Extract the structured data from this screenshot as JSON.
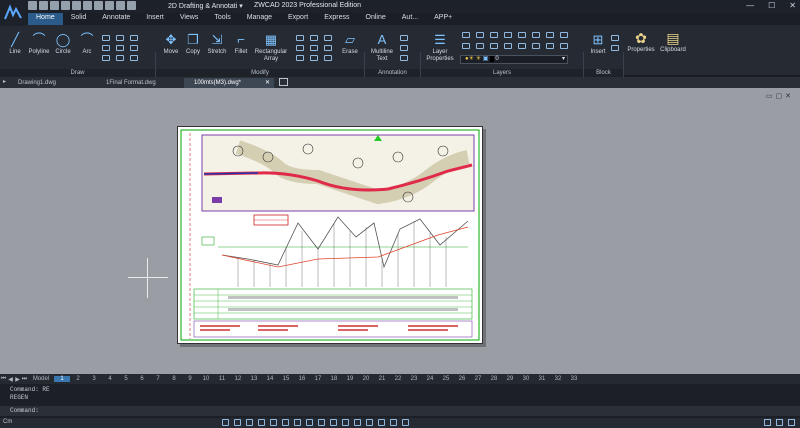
{
  "window": {
    "workspace": "2D Drafting & Annotati",
    "title": "ZWCAD 2023 Professional Edition",
    "controls": [
      "—",
      "☐",
      "✕"
    ]
  },
  "menu_tabs": [
    "Home",
    "Solid",
    "Annotate",
    "Insert",
    "Views",
    "Tools",
    "Manage",
    "Export",
    "Express",
    "Online",
    "Aut...",
    "APP+"
  ],
  "ribbon": {
    "draw": [
      "Line",
      "Polyline",
      "Circle",
      "Arc"
    ],
    "modify": [
      "Move",
      "Copy",
      "Stretch",
      "Fillet",
      "Rectangular Array"
    ],
    "erase": "Erase",
    "multiline_text": "Multiline Text",
    "layer_properties": "Layer Properties",
    "layer_value": "0",
    "insert": "Insert",
    "properties": "Properties",
    "clipboard": "Clipboard",
    "groups": [
      "Draw",
      "Modify",
      "Annotation",
      "Layers",
      "Block"
    ]
  },
  "doc_tabs": [
    "Drawing1.dwg",
    "1Final Format.dwg",
    "100mts(M3).dwg*"
  ],
  "layout_tabs": {
    "model": "Model",
    "numbers": [
      "1",
      "2",
      "3",
      "4",
      "5",
      "6",
      "7",
      "8",
      "9",
      "10",
      "11",
      "12",
      "13",
      "14",
      "15",
      "16",
      "17",
      "18",
      "19",
      "20",
      "21",
      "22",
      "23",
      "24",
      "25",
      "26",
      "27",
      "28",
      "29",
      "30",
      "31",
      "32",
      "33"
    ]
  },
  "command_history": [
    "Command:  RE",
    "REGEN"
  ],
  "command_prompt": "Command:",
  "status_left": "Cm"
}
